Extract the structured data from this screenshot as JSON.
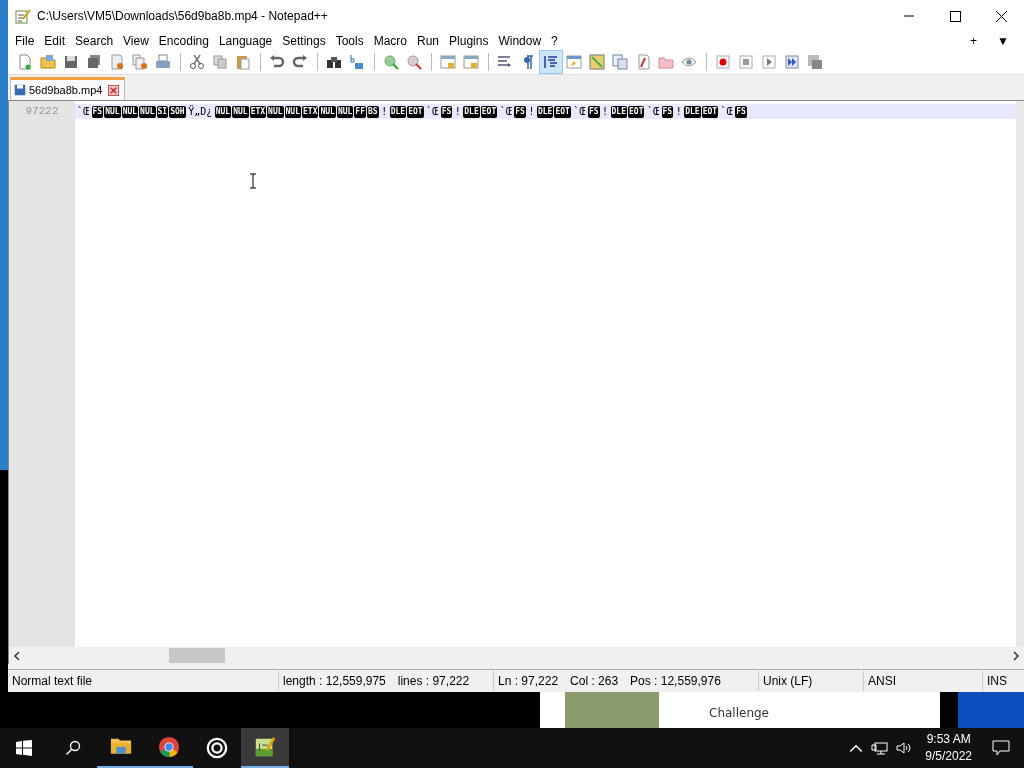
{
  "window": {
    "title": "C:\\Users\\VM5\\Downloads\\56d9ba8b.mp4 - Notepad++"
  },
  "menu": [
    "File",
    "Edit",
    "Search",
    "View",
    "Encoding",
    "Language",
    "Settings",
    "Tools",
    "Macro",
    "Run",
    "Plugins",
    "Window",
    "?"
  ],
  "menu_right": [
    "+",
    "▼"
  ],
  "toolbar": [
    {
      "kind": "button",
      "pressed": false
    },
    {
      "kind": "button",
      "pressed": false
    },
    {
      "kind": "button",
      "pressed": false
    },
    {
      "kind": "button",
      "pressed": false
    },
    {
      "kind": "button",
      "pressed": false
    },
    {
      "kind": "button",
      "pressed": false
    },
    {
      "kind": "button",
      "pressed": false
    },
    {
      "kind": "separator"
    },
    {
      "kind": "button",
      "pressed": false
    },
    {
      "kind": "button",
      "pressed": false
    },
    {
      "kind": "button",
      "pressed": false
    },
    {
      "kind": "separator"
    },
    {
      "kind": "button",
      "pressed": false
    },
    {
      "kind": "button",
      "pressed": false
    },
    {
      "kind": "separator"
    },
    {
      "kind": "button",
      "pressed": false
    },
    {
      "kind": "button",
      "pressed": false
    },
    {
      "kind": "separator"
    },
    {
      "kind": "button",
      "pressed": false
    },
    {
      "kind": "button",
      "pressed": false
    },
    {
      "kind": "separator"
    },
    {
      "kind": "button",
      "pressed": false
    },
    {
      "kind": "button",
      "pressed": false
    },
    {
      "kind": "separator"
    },
    {
      "kind": "button",
      "pressed": false
    },
    {
      "kind": "button",
      "pressed": false
    },
    {
      "kind": "button",
      "pressed": true
    },
    {
      "kind": "button",
      "pressed": false
    },
    {
      "kind": "button",
      "pressed": false
    },
    {
      "kind": "button",
      "pressed": false
    },
    {
      "kind": "button",
      "pressed": false
    },
    {
      "kind": "button",
      "pressed": false
    },
    {
      "kind": "button",
      "pressed": false
    },
    {
      "kind": "separator"
    },
    {
      "kind": "button",
      "pressed": false
    },
    {
      "kind": "button",
      "pressed": false
    },
    {
      "kind": "button",
      "pressed": false
    },
    {
      "kind": "button",
      "pressed": false
    },
    {
      "kind": "button",
      "pressed": false
    }
  ],
  "tabs": [
    {
      "label": "56d9ba8b.mp4",
      "selected": true
    }
  ],
  "editor": {
    "line_number": "97222",
    "segments": [
      {
        "kind": "text",
        "text": "`Œ"
      },
      {
        "kind": "ctrl",
        "text": "FS"
      },
      {
        "kind": "ctrl",
        "text": "NUL"
      },
      {
        "kind": "ctrl",
        "text": "NUL"
      },
      {
        "kind": "ctrl",
        "text": "NUL"
      },
      {
        "kind": "ctrl",
        "text": "SI"
      },
      {
        "kind": "ctrl",
        "text": "SOH"
      },
      {
        "kind": "text",
        "text": "Ÿ„D¿"
      },
      {
        "kind": "ctrl",
        "text": "NUL"
      },
      {
        "kind": "ctrl",
        "text": "NUL"
      },
      {
        "kind": "ctrl",
        "text": "ETX"
      },
      {
        "kind": "ctrl",
        "text": "NUL"
      },
      {
        "kind": "ctrl",
        "text": "NUL"
      },
      {
        "kind": "ctrl",
        "text": "ETX"
      },
      {
        "kind": "ctrl",
        "text": "NUL"
      },
      {
        "kind": "ctrl",
        "text": "NUL"
      },
      {
        "kind": "ctrl",
        "text": "FF"
      },
      {
        "kind": "ctrl",
        "text": "BS"
      },
      {
        "kind": "text",
        "text": "!"
      },
      {
        "kind": "ctrl",
        "text": "DLE"
      },
      {
        "kind": "ctrl",
        "text": "EOT"
      },
      {
        "kind": "text",
        "text": "`Œ"
      },
      {
        "kind": "ctrl",
        "text": "FS"
      },
      {
        "kind": "text",
        "text": "!"
      },
      {
        "kind": "ctrl",
        "text": "DLE"
      },
      {
        "kind": "ctrl",
        "text": "EOT"
      },
      {
        "kind": "text",
        "text": "`Œ"
      },
      {
        "kind": "ctrl",
        "text": "FS"
      },
      {
        "kind": "text",
        "text": "!"
      },
      {
        "kind": "ctrl",
        "text": "DLE"
      },
      {
        "kind": "ctrl",
        "text": "EOT"
      },
      {
        "kind": "text",
        "text": "`Œ"
      },
      {
        "kind": "ctrl",
        "text": "FS"
      },
      {
        "kind": "text",
        "text": "!"
      },
      {
        "kind": "ctrl",
        "text": "DLE"
      },
      {
        "kind": "ctrl",
        "text": "EOT"
      },
      {
        "kind": "text",
        "text": "`Œ"
      },
      {
        "kind": "ctrl",
        "text": "FS"
      },
      {
        "kind": "text",
        "text": "!"
      },
      {
        "kind": "ctrl",
        "text": "DLE"
      },
      {
        "kind": "ctrl",
        "text": "EOT"
      },
      {
        "kind": "text",
        "text": "`Œ"
      },
      {
        "kind": "ctrl",
        "text": "FS"
      }
    ]
  },
  "status_bar": [
    [
      "Normal text file"
    ],
    [
      "length : 12,559,975",
      "lines : 97,222"
    ],
    [
      "Ln : 97,222",
      "Col : 263",
      "Pos : 12,559,976"
    ],
    [
      "Unix (LF)"
    ],
    [
      "ANSI"
    ],
    [
      "INS"
    ]
  ],
  "notification": {
    "text": "Challenge"
  },
  "taskbar": {
    "apps": [
      {
        "kind": "explorer",
        "running": true,
        "active": false
      },
      {
        "kind": "browser",
        "running": true,
        "active": false
      },
      {
        "kind": "target",
        "running": false,
        "active": false
      },
      {
        "kind": "notepad",
        "running": true,
        "active": true
      }
    ],
    "time": "9:53 AM",
    "date": "9/5/2022"
  }
}
